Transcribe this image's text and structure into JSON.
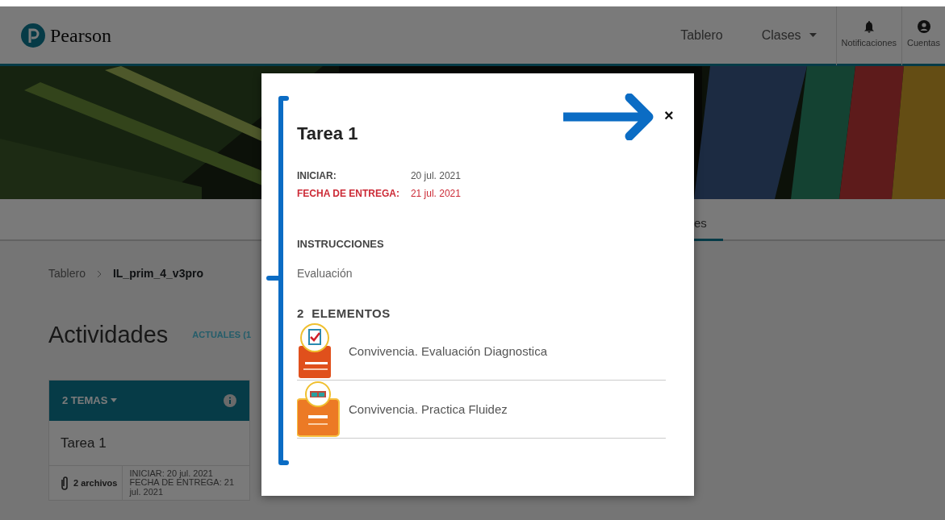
{
  "header": {
    "logo": "Pearson",
    "nav": [
      {
        "label": "Tablero",
        "kind": "link"
      },
      {
        "label": "Clases",
        "kind": "dropdown"
      }
    ],
    "actions": [
      {
        "label": "Notificaciones",
        "kind": "bell"
      },
      {
        "label": "Cuentas",
        "kind": "user"
      }
    ]
  },
  "tabs": [
    {
      "label": "es",
      "selected": true
    }
  ],
  "breadcrumb": [
    "Tablero",
    "IL_prim_4_v3pro"
  ],
  "page_title": "Actividades",
  "filter": "ACTUALES (1",
  "topics_card": {
    "header": "2 TEMAS",
    "assignment": {
      "title": "Tarea 1",
      "files": "2 archivos",
      "dates": "INICIAR: 20 jul. 2021 FECHA DE ENTREGA: 21 jul. 2021"
    }
  },
  "modal": {
    "close": "×",
    "title": "Tarea 1",
    "dates": [
      {
        "label": "INICIAR:",
        "value": "20 jul. 2021",
        "overdue": false
      },
      {
        "label": "FECHA DE ENTREGA:",
        "value": "21 jul. 2021",
        "overdue": true
      }
    ],
    "instructions_heading": "INSTRUCCIONES",
    "instructions": "Evaluación",
    "items_heading": "2  ELEMENTOS",
    "items": [
      {
        "title": "Convivencia. Evaluación Diagnostica",
        "kind": "evaluation"
      },
      {
        "title": "Convivencia. Practica Fluidez",
        "kind": "practice"
      }
    ]
  }
}
